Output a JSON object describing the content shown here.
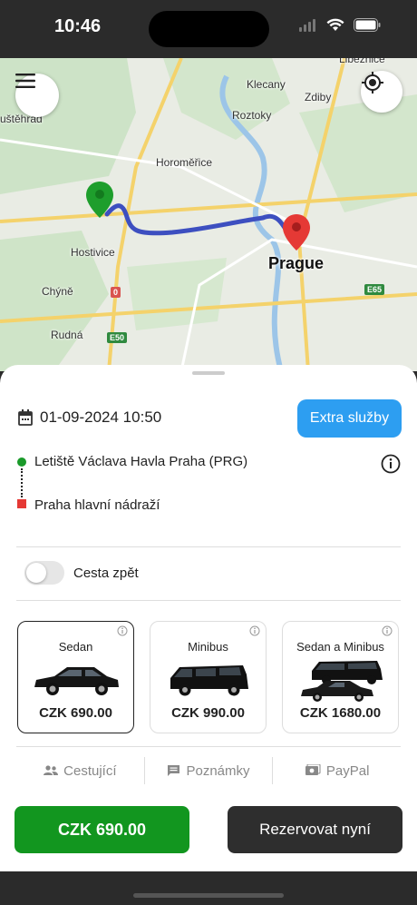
{
  "status": {
    "time": "10:46"
  },
  "map": {
    "labels": [
      "Klecany",
      "Zdiby",
      "Roztoky",
      "Horoměřice",
      "Hostivice",
      "Chýně",
      "Rudná",
      "uštěhrad",
      "Libeznice"
    ],
    "city": "Prague",
    "roads": [
      "E65",
      "E50",
      "0"
    ],
    "route_color": "#3d4fc0"
  },
  "sheet": {
    "datetime": "01-09-2024 10:50",
    "extra_label": "Extra služby",
    "pickup": "Letiště Václava Havla Praha (PRG)",
    "dropoff": "Praha hlavní nádraží",
    "return_label": "Cesta zpět",
    "cars": [
      {
        "name": "Sedan",
        "price": "CZK 690.00",
        "selected": true
      },
      {
        "name": "Minibus",
        "price": "CZK 990.00",
        "selected": false
      },
      {
        "name": "Sedan a Minibus",
        "price": "CZK 1680.00",
        "selected": false
      }
    ],
    "tabs": [
      {
        "label": "Cestující",
        "icon": "people-icon"
      },
      {
        "label": "Poznámky",
        "icon": "note-icon"
      },
      {
        "label": "PayPal",
        "icon": "payment-icon"
      }
    ],
    "total_price": "CZK 690.00",
    "book_label": "Rezervovat nyní"
  },
  "colors": {
    "accent_blue": "#2d9ef1",
    "price_green": "#12961f",
    "dark_button": "#2e2e2e"
  }
}
